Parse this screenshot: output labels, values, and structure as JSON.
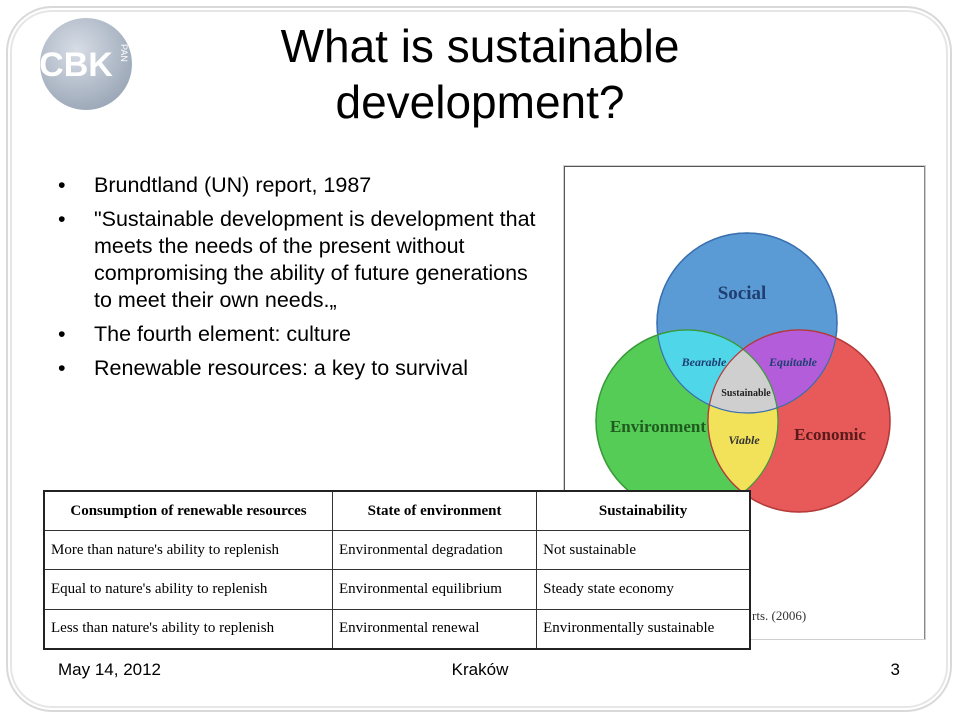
{
  "logo": {
    "text": "CBK",
    "sub": "PAN"
  },
  "slide": {
    "title": "What is sustainable development?"
  },
  "bullets": [
    "Brundtland  (UN) report, 1987",
    "\"Sustainable development is development that meets the needs of the present without compromising the ability of future generations to meet their own needs.„",
    "The fourth element: culture",
    "Renewable resources: a key to survival"
  ],
  "diagram": {
    "circles": {
      "social": "Social",
      "environment": "Environment",
      "economic": "Economic"
    },
    "overlaps": {
      "bearable": "Bearable",
      "equitable": "Equitable",
      "viable": "Viable",
      "sustainable": "Sustainable"
    },
    "credit": "rts. (2006)",
    "colors": {
      "social": "#5b9bd5",
      "environment": "#55cc55",
      "economic": "#e85a5a",
      "bearable": "#4fd6e8",
      "equitable": "#b45ddb",
      "viable": "#f2e25a",
      "sustainable": "#cfcfcf"
    }
  },
  "table": {
    "headers": [
      "Consumption of renewable resources",
      "State of environment",
      "Sustainability"
    ],
    "rows": [
      [
        "More than nature's ability to replenish",
        "Environmental degradation",
        "Not sustainable"
      ],
      [
        "Equal to nature's ability to replenish",
        "Environmental equilibrium",
        "Steady state economy"
      ],
      [
        "Less than nature's ability to replenish",
        "Environmental renewal",
        "Environmentally sustainable"
      ]
    ]
  },
  "footer": {
    "date": "May 14,  2012",
    "place": "Kraków",
    "page": "3"
  }
}
